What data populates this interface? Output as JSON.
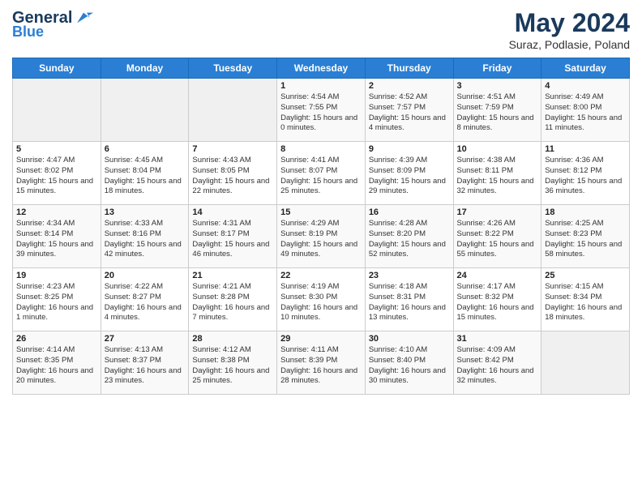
{
  "header": {
    "logo_line1": "General",
    "logo_line2": "Blue",
    "month": "May 2024",
    "location": "Suraz, Podlasie, Poland"
  },
  "days_of_week": [
    "Sunday",
    "Monday",
    "Tuesday",
    "Wednesday",
    "Thursday",
    "Friday",
    "Saturday"
  ],
  "weeks": [
    [
      {
        "day": "",
        "info": ""
      },
      {
        "day": "",
        "info": ""
      },
      {
        "day": "",
        "info": ""
      },
      {
        "day": "1",
        "info": "Sunrise: 4:54 AM\nSunset: 7:55 PM\nDaylight: 15 hours and 0 minutes."
      },
      {
        "day": "2",
        "info": "Sunrise: 4:52 AM\nSunset: 7:57 PM\nDaylight: 15 hours and 4 minutes."
      },
      {
        "day": "3",
        "info": "Sunrise: 4:51 AM\nSunset: 7:59 PM\nDaylight: 15 hours and 8 minutes."
      },
      {
        "day": "4",
        "info": "Sunrise: 4:49 AM\nSunset: 8:00 PM\nDaylight: 15 hours and 11 minutes."
      }
    ],
    [
      {
        "day": "5",
        "info": "Sunrise: 4:47 AM\nSunset: 8:02 PM\nDaylight: 15 hours and 15 minutes."
      },
      {
        "day": "6",
        "info": "Sunrise: 4:45 AM\nSunset: 8:04 PM\nDaylight: 15 hours and 18 minutes."
      },
      {
        "day": "7",
        "info": "Sunrise: 4:43 AM\nSunset: 8:05 PM\nDaylight: 15 hours and 22 minutes."
      },
      {
        "day": "8",
        "info": "Sunrise: 4:41 AM\nSunset: 8:07 PM\nDaylight: 15 hours and 25 minutes."
      },
      {
        "day": "9",
        "info": "Sunrise: 4:39 AM\nSunset: 8:09 PM\nDaylight: 15 hours and 29 minutes."
      },
      {
        "day": "10",
        "info": "Sunrise: 4:38 AM\nSunset: 8:11 PM\nDaylight: 15 hours and 32 minutes."
      },
      {
        "day": "11",
        "info": "Sunrise: 4:36 AM\nSunset: 8:12 PM\nDaylight: 15 hours and 36 minutes."
      }
    ],
    [
      {
        "day": "12",
        "info": "Sunrise: 4:34 AM\nSunset: 8:14 PM\nDaylight: 15 hours and 39 minutes."
      },
      {
        "day": "13",
        "info": "Sunrise: 4:33 AM\nSunset: 8:16 PM\nDaylight: 15 hours and 42 minutes."
      },
      {
        "day": "14",
        "info": "Sunrise: 4:31 AM\nSunset: 8:17 PM\nDaylight: 15 hours and 46 minutes."
      },
      {
        "day": "15",
        "info": "Sunrise: 4:29 AM\nSunset: 8:19 PM\nDaylight: 15 hours and 49 minutes."
      },
      {
        "day": "16",
        "info": "Sunrise: 4:28 AM\nSunset: 8:20 PM\nDaylight: 15 hours and 52 minutes."
      },
      {
        "day": "17",
        "info": "Sunrise: 4:26 AM\nSunset: 8:22 PM\nDaylight: 15 hours and 55 minutes."
      },
      {
        "day": "18",
        "info": "Sunrise: 4:25 AM\nSunset: 8:23 PM\nDaylight: 15 hours and 58 minutes."
      }
    ],
    [
      {
        "day": "19",
        "info": "Sunrise: 4:23 AM\nSunset: 8:25 PM\nDaylight: 16 hours and 1 minute."
      },
      {
        "day": "20",
        "info": "Sunrise: 4:22 AM\nSunset: 8:27 PM\nDaylight: 16 hours and 4 minutes."
      },
      {
        "day": "21",
        "info": "Sunrise: 4:21 AM\nSunset: 8:28 PM\nDaylight: 16 hours and 7 minutes."
      },
      {
        "day": "22",
        "info": "Sunrise: 4:19 AM\nSunset: 8:30 PM\nDaylight: 16 hours and 10 minutes."
      },
      {
        "day": "23",
        "info": "Sunrise: 4:18 AM\nSunset: 8:31 PM\nDaylight: 16 hours and 13 minutes."
      },
      {
        "day": "24",
        "info": "Sunrise: 4:17 AM\nSunset: 8:32 PM\nDaylight: 16 hours and 15 minutes."
      },
      {
        "day": "25",
        "info": "Sunrise: 4:15 AM\nSunset: 8:34 PM\nDaylight: 16 hours and 18 minutes."
      }
    ],
    [
      {
        "day": "26",
        "info": "Sunrise: 4:14 AM\nSunset: 8:35 PM\nDaylight: 16 hours and 20 minutes."
      },
      {
        "day": "27",
        "info": "Sunrise: 4:13 AM\nSunset: 8:37 PM\nDaylight: 16 hours and 23 minutes."
      },
      {
        "day": "28",
        "info": "Sunrise: 4:12 AM\nSunset: 8:38 PM\nDaylight: 16 hours and 25 minutes."
      },
      {
        "day": "29",
        "info": "Sunrise: 4:11 AM\nSunset: 8:39 PM\nDaylight: 16 hours and 28 minutes."
      },
      {
        "day": "30",
        "info": "Sunrise: 4:10 AM\nSunset: 8:40 PM\nDaylight: 16 hours and 30 minutes."
      },
      {
        "day": "31",
        "info": "Sunrise: 4:09 AM\nSunset: 8:42 PM\nDaylight: 16 hours and 32 minutes."
      },
      {
        "day": "",
        "info": ""
      }
    ]
  ]
}
